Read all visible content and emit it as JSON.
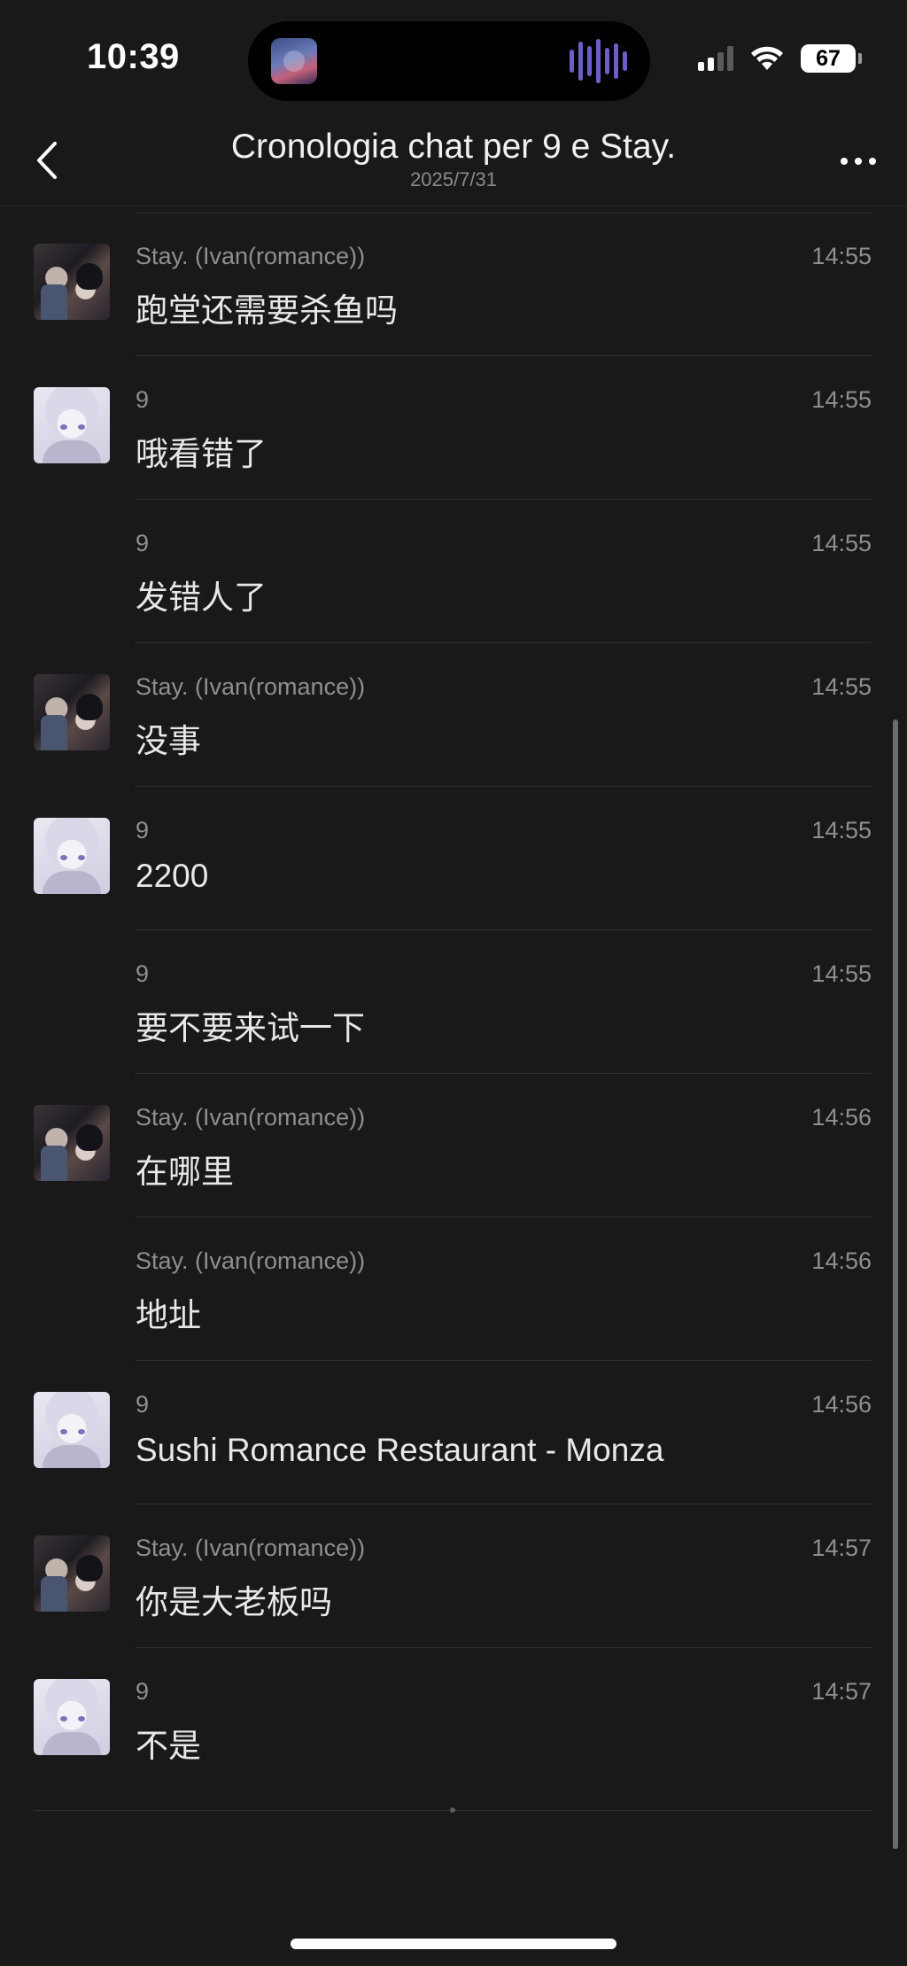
{
  "status_bar": {
    "time": "10:39",
    "battery": "67"
  },
  "nav": {
    "title": "Cronologia chat per 9 e Stay.",
    "subtitle": "2025/7/31"
  },
  "messages": [
    {
      "sender": "Stay. (Ivan(romance))",
      "time": "14:55",
      "text": "跑堂还需要杀鱼吗",
      "avatar": "stay"
    },
    {
      "sender": "9",
      "time": "14:55",
      "text": "哦看错了",
      "avatar": "nine"
    },
    {
      "sender": "9",
      "time": "14:55",
      "text": "发错人了",
      "avatar": ""
    },
    {
      "sender": "Stay. (Ivan(romance))",
      "time": "14:55",
      "text": "没事",
      "avatar": "stay"
    },
    {
      "sender": "9",
      "time": "14:55",
      "text": "2200",
      "avatar": "nine"
    },
    {
      "sender": "9",
      "time": "14:55",
      "text": "要不要来试一下",
      "avatar": ""
    },
    {
      "sender": "Stay. (Ivan(romance))",
      "time": "14:56",
      "text": "在哪里",
      "avatar": "stay"
    },
    {
      "sender": "Stay. (Ivan(romance))",
      "time": "14:56",
      "text": "地址",
      "avatar": ""
    },
    {
      "sender": "9",
      "time": "14:56",
      "text": "Sushi Romance Restaurant - Monza",
      "avatar": "nine"
    },
    {
      "sender": "Stay. (Ivan(romance))",
      "time": "14:57",
      "text": "你是大老板吗",
      "avatar": "stay"
    },
    {
      "sender": "9",
      "time": "14:57",
      "text": "不是",
      "avatar": "nine"
    }
  ]
}
